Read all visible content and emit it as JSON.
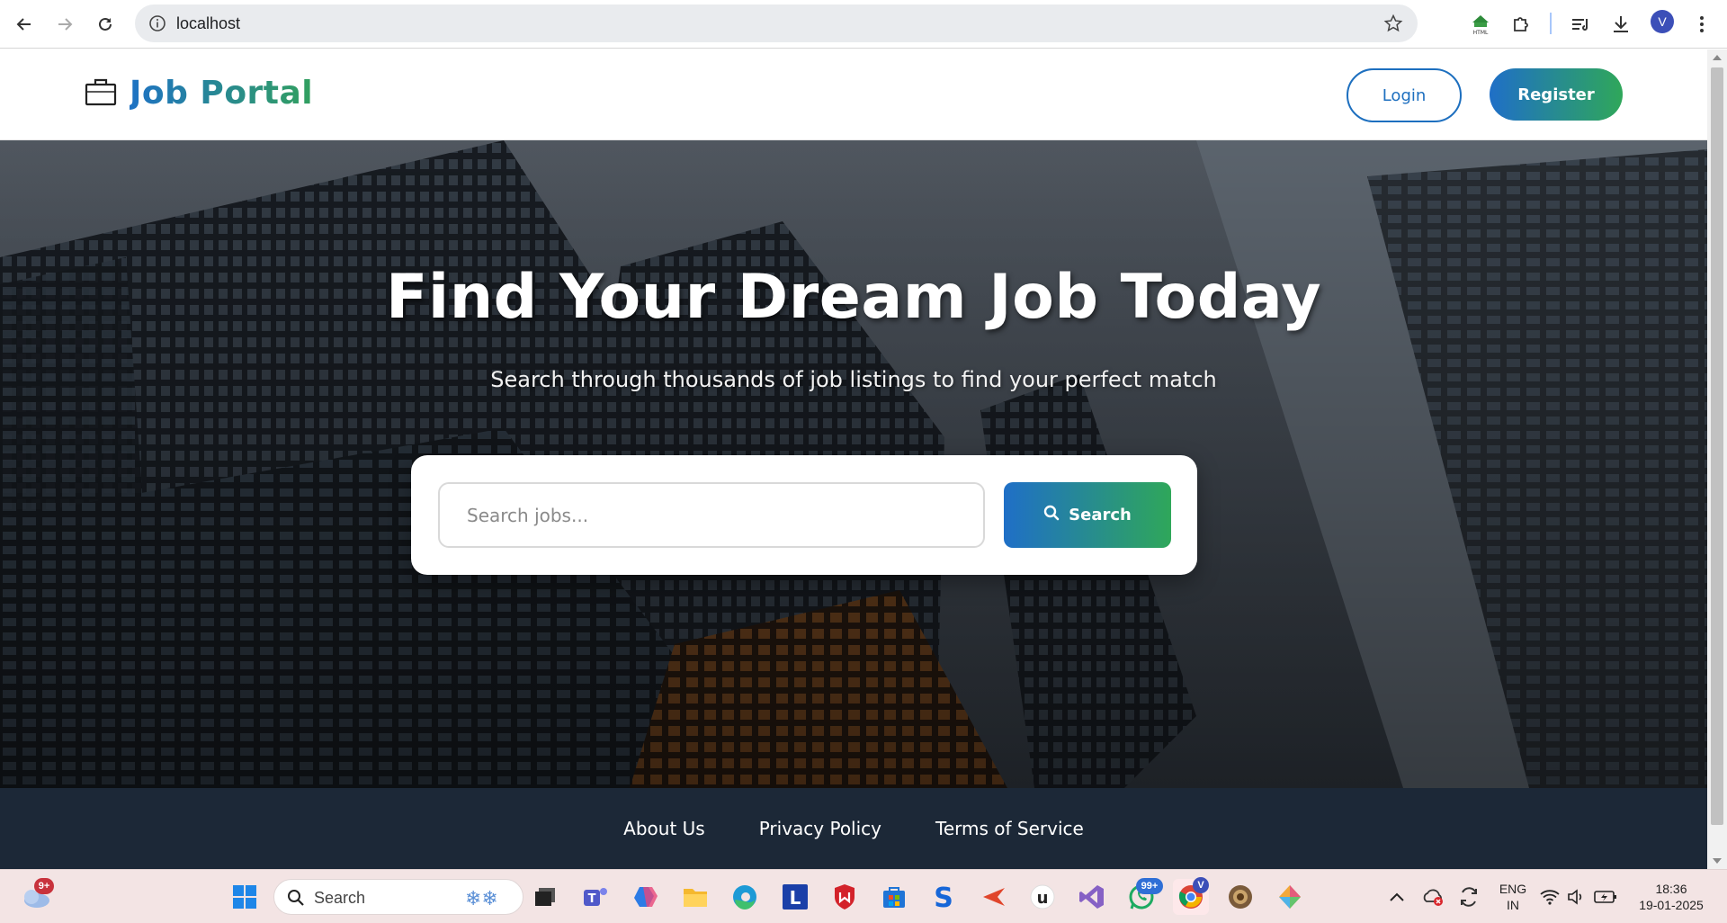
{
  "browser": {
    "url": "localhost",
    "profile_initial": "V"
  },
  "site": {
    "brand": "Job Portal",
    "login_label": "Login",
    "register_label": "Register"
  },
  "hero": {
    "title": "Find Your Dream Job Today",
    "subtitle": "Search through thousands of job listings to find your perfect match",
    "search_placeholder": "Search jobs...",
    "search_button": "Search"
  },
  "footer": {
    "links": [
      "About Us",
      "Privacy Policy",
      "Terms of Service"
    ]
  },
  "taskbar": {
    "weather_badge": "9+",
    "search_label": "Search",
    "whatsapp_badge": "99+",
    "chrome_profile_badge": "V",
    "language_top": "ENG",
    "language_bottom": "IN",
    "time": "18:36",
    "date": "19-01-2025"
  },
  "colors": {
    "brand_gradient_start": "#1e72c4",
    "brand_gradient_end": "#32a05f",
    "footer_bg": "#1c2837"
  }
}
